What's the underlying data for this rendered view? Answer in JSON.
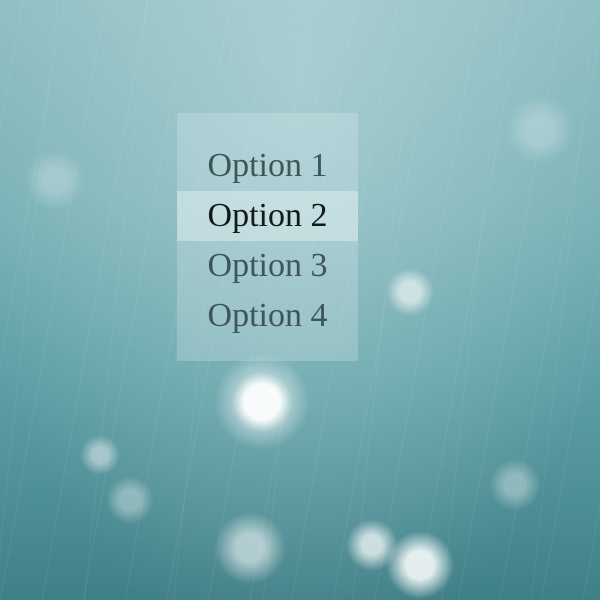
{
  "menu": {
    "options": [
      {
        "label": "Option 1"
      },
      {
        "label": "Option 2"
      },
      {
        "label": "Option 3"
      },
      {
        "label": "Option 4"
      }
    ],
    "selected_index": 1
  },
  "colors": {
    "text": "#3f5659",
    "selected_text": "#12191a"
  }
}
